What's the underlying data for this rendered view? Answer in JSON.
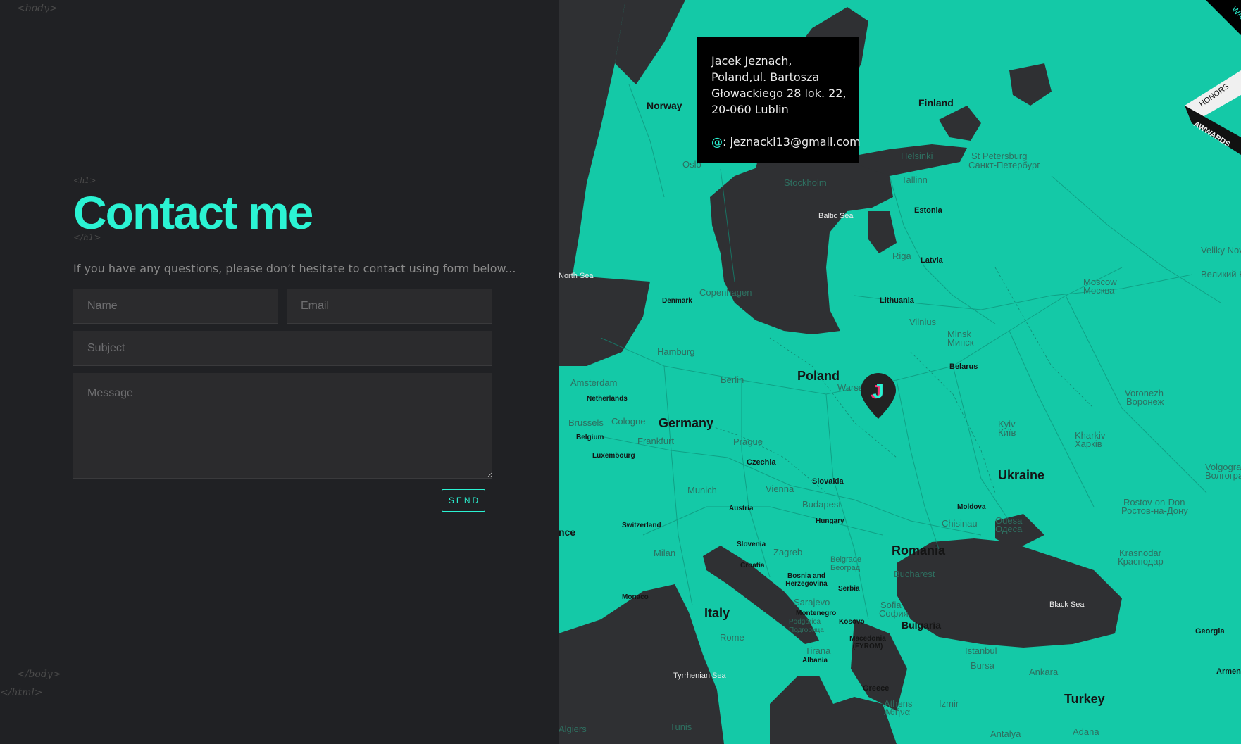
{
  "page": {
    "tags": {
      "body_open": "<body>",
      "h1_open": "<h1>",
      "h1_close": "</h1>",
      "body_close": "</body>",
      "html_close": "</html>"
    },
    "title": "Contact me",
    "intro": "If you have any questions, please don’t hesitate to contact using form below..."
  },
  "form": {
    "name_placeholder": "Name",
    "email_placeholder": "Email",
    "subject_placeholder": "Subject",
    "message_placeholder": "Message",
    "send_label": "SEND"
  },
  "info_box": {
    "line1": "Jacek Jeznach,",
    "line2": "Poland,ul. Bartosza",
    "line3": "Głowackiego 28 lok. 22,",
    "line4": "20-060 Lublin",
    "email_prefix": "@",
    "email": ": jeznacki13@gmail.com"
  },
  "map": {
    "pin_letter": "J",
    "countries": [
      "Norway",
      "Finland",
      "Estonia",
      "Latvia",
      "Lithuania",
      "Denmark",
      "Poland",
      "Belarus",
      "Germany",
      "Netherlands",
      "Belgium",
      "Luxembourg",
      "Czechia",
      "Slovakia",
      "Ukraine",
      "Austria",
      "Hungary",
      "Moldova",
      "Switzerland",
      "Slovenia",
      "Croatia",
      "Romania",
      "Bosnia and Herzegovina",
      "Serbia",
      "Montenegro",
      "Kosovo",
      "Bulgaria",
      "Italy",
      "Monaco",
      "Macedonia (FYROM)",
      "Albania",
      "Greece",
      "Turkey",
      "Georgia",
      "Armen",
      "nce"
    ],
    "cities": [
      "Oslo",
      "Stockholm",
      "Helsinki",
      "St Petersburg",
      "Санкт-Петербург",
      "Tallinn",
      "Riga",
      "Copenhagen",
      "Hamburg",
      "Berlin",
      "Amsterdam",
      "Brussels",
      "Cologne",
      "Frankfurt",
      "Prague",
      "Warsaw",
      "Vilnius",
      "Minsk",
      "Минск",
      "Moscow",
      "Москва",
      "Veliky Novgorod",
      "Великий Новгород",
      "Kyiv",
      "Київ",
      "Kharkiv",
      "Харків",
      "Voronezh",
      "Воронеж",
      "Munich",
      "Vienna",
      "Budapest",
      "Zagreb",
      "Milan",
      "Belgrade",
      "Београд",
      "Sarajevo",
      "Sofia",
      "София",
      "Bucharest",
      "Chisinau",
      "Odesa",
      "Одеса",
      "Rostov-on-Don",
      "Ростов-на-Дону",
      "Krasnodar",
      "Краснодар",
      "Volgograd",
      "Волгоград",
      "Rome",
      "Podgorica",
      "Подгорица",
      "Tirana",
      "Istanbul",
      "Bursa",
      "Ankara",
      "Izmir",
      "Athens",
      "Αθήνα",
      "Antalya",
      "Adana",
      "Tunis",
      "Algiers"
    ],
    "seas": [
      "Baltic Sea",
      "North Sea",
      "Black Sea",
      "Tyrrhenian Sea"
    ]
  },
  "badge": {
    "top": "WAL",
    "honors": "HONORS",
    "awards": "AWWARDS"
  },
  "colors": {
    "accent": "#2bf3d3",
    "land": "#14c9a7",
    "water": "#2f3033",
    "panel": "#202124"
  }
}
